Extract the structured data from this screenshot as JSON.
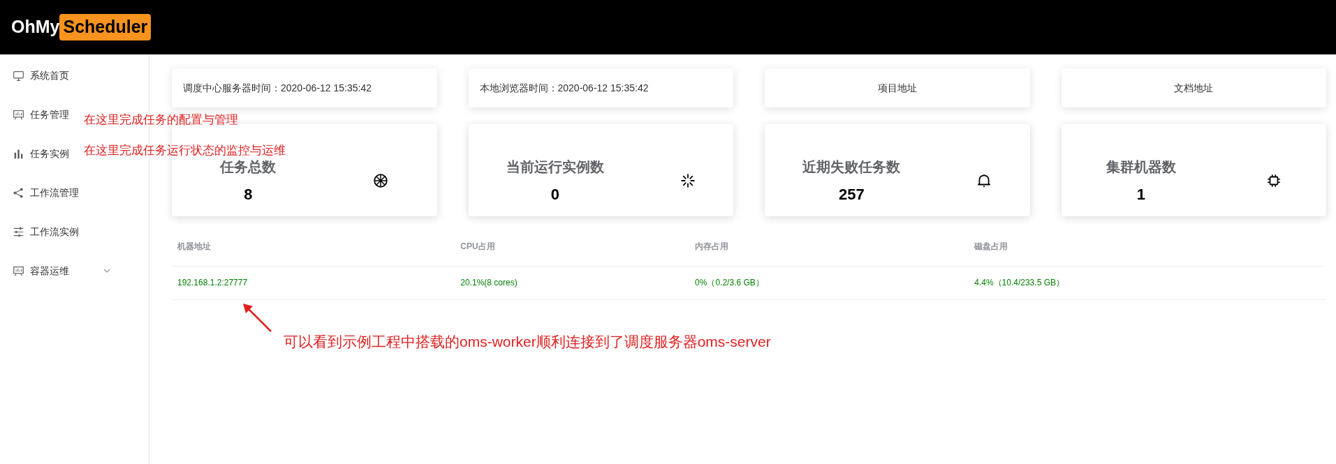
{
  "header": {
    "logo_left": "OhMy",
    "logo_right": "Scheduler"
  },
  "sidebar": {
    "items": [
      {
        "label": "系统首页",
        "kind": "link"
      },
      {
        "label": "任务管理",
        "kind": "link"
      },
      {
        "label": "任务实例",
        "kind": "link"
      },
      {
        "label": "工作流管理",
        "kind": "link"
      },
      {
        "label": "工作流实例",
        "kind": "link"
      },
      {
        "label": "容器运维",
        "kind": "submenu",
        "expanded": false
      }
    ]
  },
  "info_cards": [
    {
      "text": "调度中心服务器时间：2020-06-12 15:35:42"
    },
    {
      "text": "本地浏览器时间：2020-06-12 15:35:42"
    },
    {
      "text": "项目地址"
    },
    {
      "text": "文档地址"
    }
  ],
  "stat_cards": [
    {
      "title": "任务总数",
      "value": "8"
    },
    {
      "title": "当前运行实例数",
      "value": "0"
    },
    {
      "title": "近期失败任务数",
      "value": "257"
    },
    {
      "title": "集群机器数",
      "value": "1"
    }
  ],
  "table": {
    "columns": [
      "机器地址",
      "CPU占用",
      "内存占用",
      "磁盘占用"
    ],
    "rows": [
      [
        "192.168.1.2:27777",
        "20.1%(8 cores)",
        "0%（0.2/3.6 GB）",
        "4.4%（10.4/233.5 GB）"
      ]
    ]
  },
  "annotations": [
    {
      "text": "在这里完成任务的配置与管理"
    },
    {
      "text": "在这里完成任务运行状态的监控与运维"
    },
    {
      "text": "可以看到示例工程中搭载的oms-worker顺利连接到了调度服务器oms-server"
    }
  ]
}
